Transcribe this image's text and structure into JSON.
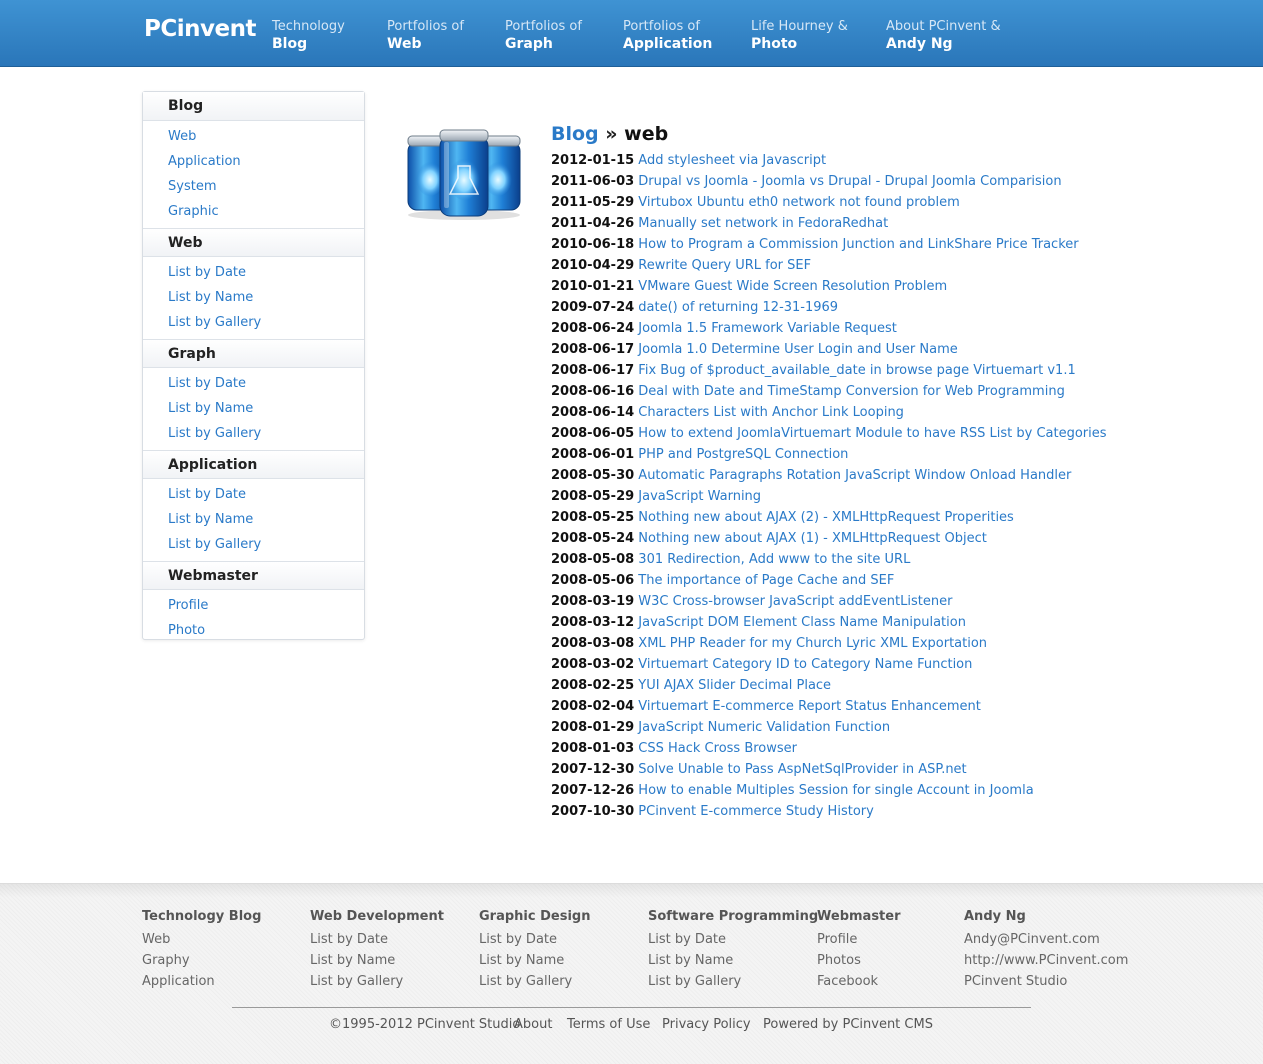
{
  "header": {
    "logo": "PCinvent",
    "nav": [
      {
        "line1": "Technology",
        "line2": "Blog"
      },
      {
        "line1": "Portfolios of",
        "line2": "Web"
      },
      {
        "line1": "Portfolios of",
        "line2": "Graph"
      },
      {
        "line1": "Portfolios of",
        "line2": "Application"
      },
      {
        "line1": "Life Hourney &",
        "line2": "Photo"
      },
      {
        "line1": "About PCinvent &",
        "line2": "Andy Ng"
      }
    ]
  },
  "sidebar": {
    "sections": [
      {
        "title": "Blog",
        "items": [
          "Web",
          "Application",
          "System",
          "Graphic"
        ]
      },
      {
        "title": "Web",
        "items": [
          "List by Date",
          "List by Name",
          "List by Gallery"
        ]
      },
      {
        "title": "Graph",
        "items": [
          "List by Date",
          "List by Name",
          "List by Gallery"
        ]
      },
      {
        "title": "Application",
        "items": [
          "List by Date",
          "List by Name",
          "List by Gallery"
        ]
      },
      {
        "title": "Webmaster",
        "items": [
          "Profile",
          "Photo"
        ]
      }
    ]
  },
  "main": {
    "breadcrumb": "Blog",
    "separator": "»",
    "current": "web",
    "entries": [
      {
        "date": "2012-01-15",
        "title": "Add stylesheet via Javascript"
      },
      {
        "date": "2011-06-03",
        "title": "Drupal vs Joomla - Joomla vs Drupal - Drupal Joomla Comparision"
      },
      {
        "date": "2011-05-29",
        "title": "Virtubox Ubuntu eth0 network not found problem"
      },
      {
        "date": "2011-04-26",
        "title": "Manually set network in FedoraRedhat"
      },
      {
        "date": "2010-06-18",
        "title": "How to Program a Commission Junction and LinkShare Price Tracker"
      },
      {
        "date": "2010-04-29",
        "title": "Rewrite Query URL for SEF"
      },
      {
        "date": "2010-01-21",
        "title": "VMware Guest Wide Screen Resolution Problem"
      },
      {
        "date": "2009-07-24",
        "title": "date() of returning 12-31-1969"
      },
      {
        "date": "2008-06-24",
        "title": "Joomla 1.5 Framework Variable Request"
      },
      {
        "date": "2008-06-17",
        "title": "Joomla 1.0 Determine User Login and User Name"
      },
      {
        "date": "2008-06-17",
        "title": "Fix Bug of $product_available_date in browse page Virtuemart v1.1"
      },
      {
        "date": "2008-06-16",
        "title": "Deal with Date and TimeStamp Conversion for Web Programming"
      },
      {
        "date": "2008-06-14",
        "title": "Characters List with Anchor Link Looping"
      },
      {
        "date": "2008-06-05",
        "title": "How to extend JoomlaVirtuemart Module to have RSS List by Categories"
      },
      {
        "date": "2008-06-01",
        "title": "PHP and PostgreSQL Connection"
      },
      {
        "date": "2008-05-30",
        "title": "Automatic Paragraphs Rotation JavaScript Window Onload Handler"
      },
      {
        "date": "2008-05-29",
        "title": "JavaScript Warning"
      },
      {
        "date": "2008-05-25",
        "title": "Nothing new about AJAX (2) - XMLHttpRequest Properities"
      },
      {
        "date": "2008-05-24",
        "title": "Nothing new about AJAX (1) - XMLHttpRequest Object"
      },
      {
        "date": "2008-05-08",
        "title": "301 Redirection, Add www to the site URL"
      },
      {
        "date": "2008-05-06",
        "title": "The importance of Page Cache and SEF"
      },
      {
        "date": "2008-03-19",
        "title": "W3C Cross-browser JavaScript addEventListener"
      },
      {
        "date": "2008-03-12",
        "title": "JavaScript DOM Element Class Name Manipulation"
      },
      {
        "date": "2008-03-08",
        "title": "XML PHP Reader for my Church Lyric XML Exportation"
      },
      {
        "date": "2008-03-02",
        "title": "Virtuemart Category ID to Category Name Function"
      },
      {
        "date": "2008-02-25",
        "title": "YUI AJAX Slider Decimal Place"
      },
      {
        "date": "2008-02-04",
        "title": "Virtuemart E-commerce Report Status Enhancement"
      },
      {
        "date": "2008-01-29",
        "title": "JavaScript Numeric Validation Function"
      },
      {
        "date": "2008-01-03",
        "title": "CSS Hack Cross Browser"
      },
      {
        "date": "2007-12-30",
        "title": "Solve Unable to Pass AspNetSqlProvider in ASP.net"
      },
      {
        "date": "2007-12-26",
        "title": "How to enable Multiples Session for single Account in Joomla"
      },
      {
        "date": "2007-10-30",
        "title": "PCinvent E-commerce Study History"
      }
    ]
  },
  "footer": {
    "columns": [
      {
        "title": "Technology Blog",
        "items": [
          "Web",
          "Graphy",
          "Application"
        ]
      },
      {
        "title": "Web Development",
        "items": [
          "List by Date",
          "List by Name",
          "List by Gallery"
        ]
      },
      {
        "title": "Graphic Design",
        "items": [
          "List by Date",
          "List by Name",
          "List by Gallery"
        ]
      },
      {
        "title": "Software Programming",
        "items": [
          "List by Date",
          "List by Name",
          "List by Gallery"
        ]
      },
      {
        "title": "Webmaster",
        "items": [
          "Profile",
          "Photos",
          "Facebook"
        ]
      },
      {
        "title": "Andy Ng",
        "items": [
          "Andy@PCinvent.com",
          "http://www.PCinvent.com",
          "PCinvent Studio"
        ]
      }
    ],
    "copyright": "©1995-2012 PCinvent Studio",
    "links": [
      "About",
      "Terms of Use",
      "Privacy Policy",
      "Powered by PCinvent CMS"
    ]
  },
  "colors": {
    "header_top": "#3f93d3",
    "header_bottom": "#2a76b9",
    "link": "#2a7ac8"
  },
  "icons": {
    "feature_art": "blue-glass-canisters-icon"
  }
}
